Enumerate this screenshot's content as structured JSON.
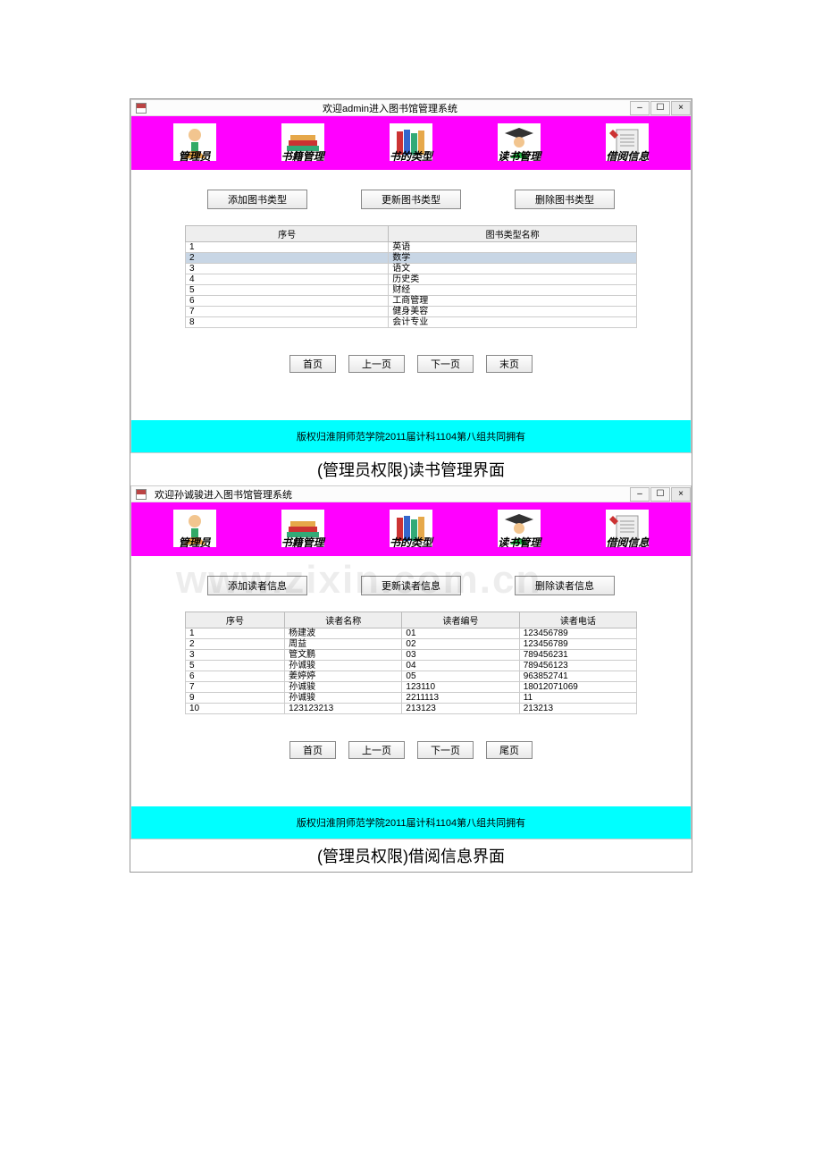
{
  "win1": {
    "title": "欢迎admin进入图书馆管理系统",
    "nav": [
      {
        "label": "管理员"
      },
      {
        "label": "书籍管理"
      },
      {
        "label": "书的类型"
      },
      {
        "label": "读书管理"
      },
      {
        "label": "借阅信息"
      }
    ],
    "actions": {
      "add": "添加图书类型",
      "update": "更新图书类型",
      "delete": "删除图书类型"
    },
    "table": {
      "headers": [
        "序号",
        "图书类型名称"
      ],
      "rows": [
        [
          "1",
          "英语"
        ],
        [
          "2",
          "数学"
        ],
        [
          "3",
          "语文"
        ],
        [
          "4",
          "历史类"
        ],
        [
          "5",
          "财经"
        ],
        [
          "6",
          "工商管理"
        ],
        [
          "7",
          "健身美容"
        ],
        [
          "8",
          "会计专业"
        ]
      ],
      "selected_index": 1
    },
    "pager": {
      "first": "首页",
      "prev": "上一页",
      "next": "下一页",
      "last": "末页"
    },
    "footer": "版权归淮阴师范学院2011届计科1104第八组共同拥有"
  },
  "caption1": "(管理员权限)读书管理界面",
  "win2": {
    "title": "欢迎孙诚骏进入图书馆管理系统",
    "nav": [
      {
        "label": "管理员"
      },
      {
        "label": "书籍管理"
      },
      {
        "label": "书的类型"
      },
      {
        "label": "读书管理"
      },
      {
        "label": "借阅信息"
      }
    ],
    "actions": {
      "add": "添加读者信息",
      "update": "更新读者信息",
      "delete": "删除读者信息"
    },
    "table": {
      "headers": [
        "序号",
        "读者名称",
        "读者编号",
        "读者电话"
      ],
      "rows": [
        [
          "1",
          "杨建波",
          "01",
          "123456789"
        ],
        [
          "2",
          "周益",
          "02",
          "123456789"
        ],
        [
          "3",
          "管文鹏",
          "03",
          "789456231"
        ],
        [
          "5",
          "孙诚骏",
          "04",
          "789456123"
        ],
        [
          "6",
          "姜婷婷",
          "05",
          "963852741"
        ],
        [
          "7",
          "孙诚骏",
          "123110",
          "18012071069"
        ],
        [
          "9",
          "孙诚骏",
          "2211113",
          "11"
        ],
        [
          "10",
          "123123213",
          "213123",
          "213213"
        ]
      ]
    },
    "pager": {
      "first": "首页",
      "prev": "上一页",
      "next": "下一页",
      "last": "尾页"
    },
    "footer": "版权归淮阴师范学院2011届计科1104第八组共同拥有"
  },
  "caption2": "(管理员权限)借阅信息界面",
  "watermark": "www.zixin.com.cn"
}
